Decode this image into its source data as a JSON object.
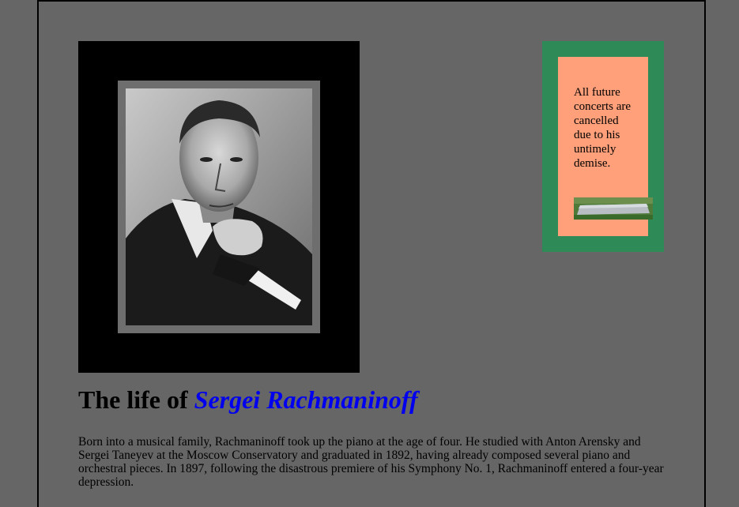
{
  "portrait": {
    "icon": "portrait-photo-icon",
    "subject": "photo of Sergei Rachmaninoff, hand under chin"
  },
  "notice": {
    "text": "All future concerts are cancelled due to his untimely demise.",
    "image_icon": "grave-photo-icon",
    "colors": {
      "outer": "#2e8b57",
      "inner": "#ffa07a"
    }
  },
  "heading": {
    "prefix": "The life of ",
    "name": "Sergei Rachmaninoff"
  },
  "bio": {
    "text": "Born into a musical family, Rachmaninoff took up the piano at the age of four. He studied with Anton Arensky and Sergei Taneyev at the Moscow Conservatory and graduated in 1892, having already composed several piano and orchestral pieces. In 1897, following the disastrous premiere of his Symphony No. 1, Rachmaninoff entered a four-year depression."
  },
  "colors": {
    "page_bg": "#666666",
    "link": "#0000ee"
  }
}
